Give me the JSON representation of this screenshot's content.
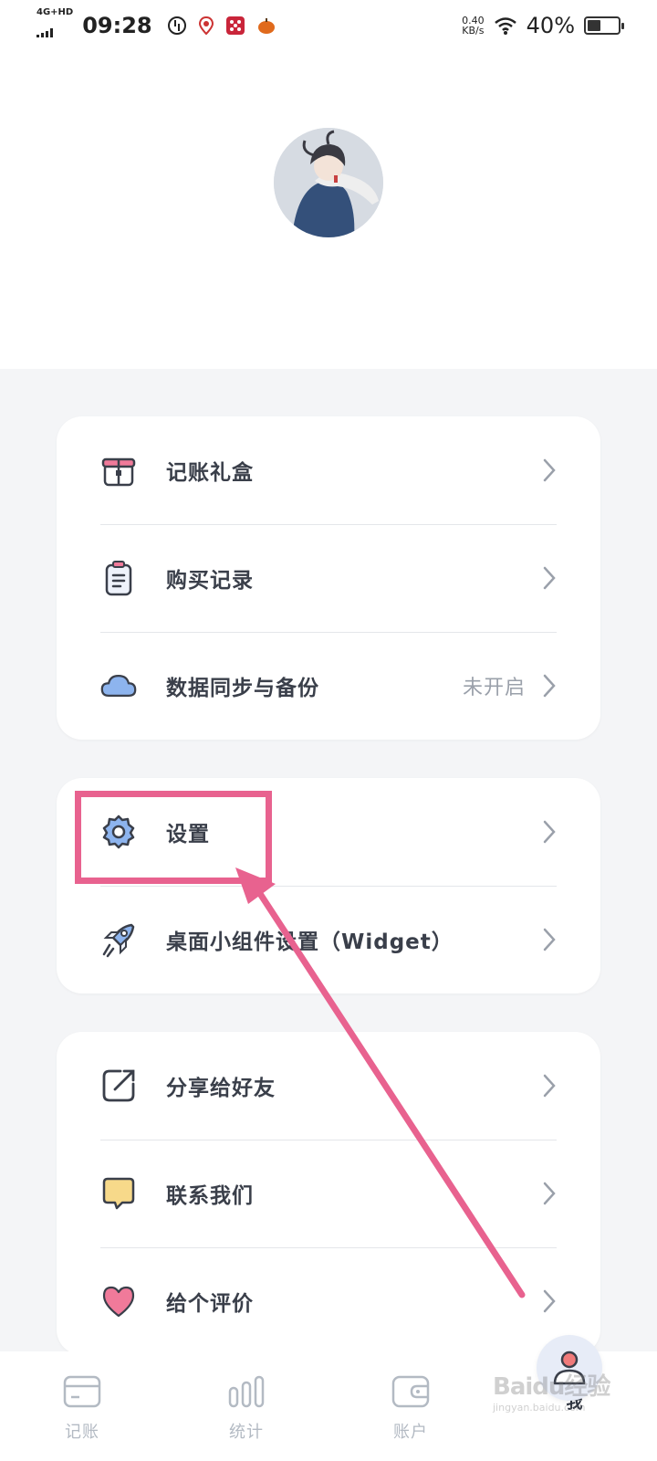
{
  "status_bar": {
    "network": "4G+HD",
    "time": "09:28",
    "speed_value": "0.40",
    "speed_unit": "KB/s",
    "battery": "40%"
  },
  "menu_group_1": [
    {
      "label": "记账礼盒",
      "icon": "gift-box-icon"
    },
    {
      "label": "购买记录",
      "icon": "clipboard-icon"
    },
    {
      "label": "数据同步与备份",
      "value": "未开启",
      "icon": "cloud-icon"
    }
  ],
  "menu_group_2": [
    {
      "label": "设置",
      "icon": "gear-icon"
    },
    {
      "label": "桌面小组件设置（Widget）",
      "icon": "rocket-icon"
    }
  ],
  "menu_group_3": [
    {
      "label": "分享给好友",
      "icon": "share-icon"
    },
    {
      "label": "联系我们",
      "icon": "message-icon"
    },
    {
      "label": "给个评价",
      "icon": "heart-icon"
    }
  ],
  "tabbar": [
    {
      "label": "记账",
      "icon": "card-icon"
    },
    {
      "label": "统计",
      "icon": "stats-icon"
    },
    {
      "label": "账户",
      "icon": "wallet-icon"
    },
    {
      "label": "我",
      "icon": "user-icon",
      "active": true
    }
  ],
  "watermark": {
    "main": "Baidu经验",
    "sub": "jingyan.baidu.com"
  },
  "colors": {
    "accent_blue": "#6f9ee8",
    "highlight_pink": "#e8628f",
    "heart_pink": "#f07a9a",
    "note_yellow": "#f7d98a"
  }
}
